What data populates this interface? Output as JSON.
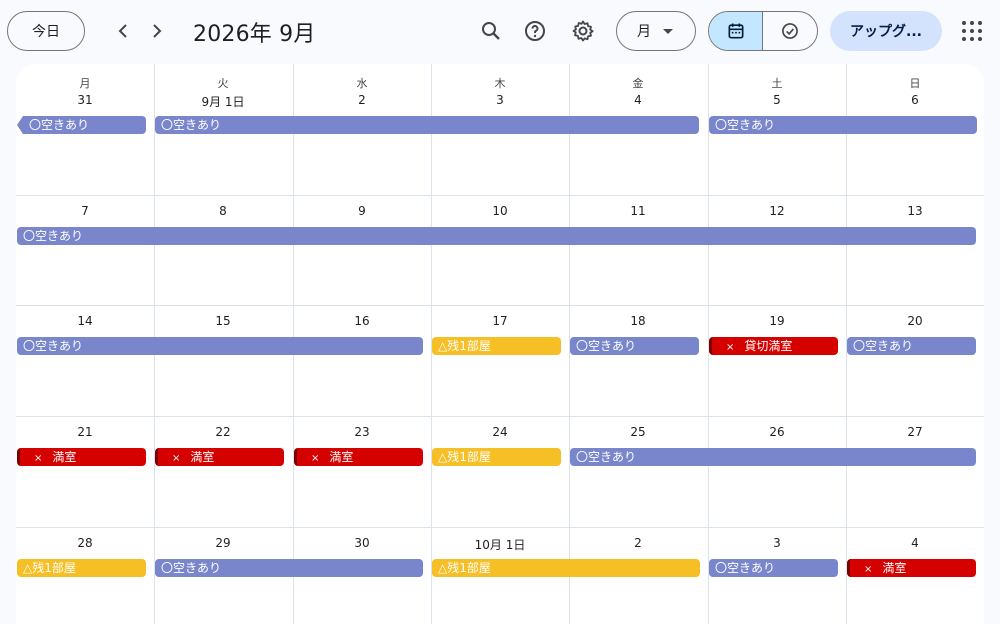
{
  "header": {
    "today_label": "今日",
    "title": "2026年 9月",
    "view_label": "月",
    "upgrade_label": "アップグ..."
  },
  "icons": {
    "prev": "chevron-left-icon",
    "next": "chevron-right-icon",
    "search": "search-icon",
    "help": "help-icon",
    "settings": "gear-icon",
    "calendar_view": "calendar-icon",
    "tasks_view": "task-check-icon",
    "apps": "apps-grid-icon"
  },
  "colors": {
    "available": "#7986cb",
    "few_left": "#f6bf26",
    "full": "#d50000",
    "active_segment": "#c2e7ff"
  },
  "weekdays": [
    "月",
    "火",
    "水",
    "木",
    "金",
    "土",
    "日"
  ],
  "weeks": [
    {
      "days": [
        "31",
        "9月 1日",
        "2",
        "3",
        "4",
        "5",
        "6"
      ]
    },
    {
      "days": [
        "7",
        "8",
        "9",
        "10",
        "11",
        "12",
        "13"
      ]
    },
    {
      "days": [
        "14",
        "15",
        "16",
        "17",
        "18",
        "19",
        "20"
      ]
    },
    {
      "days": [
        "21",
        "22",
        "23",
        "24",
        "25",
        "26",
        "27"
      ]
    },
    {
      "days": [
        "28",
        "29",
        "30",
        "10月 1日",
        "2",
        "3",
        "4"
      ]
    }
  ],
  "events": [
    {
      "week": 0,
      "start": 0,
      "span": 1,
      "type": "avail",
      "label": "〇空きあり",
      "cont_left": true
    },
    {
      "week": 0,
      "start": 1,
      "span": 4,
      "type": "avail",
      "label": "〇空きあり"
    },
    {
      "week": 0,
      "start": 5,
      "span": 2,
      "type": "avail",
      "label": "〇空きあり"
    },
    {
      "week": 1,
      "start": 0,
      "span": 7,
      "type": "avail",
      "label": "〇空きあり"
    },
    {
      "week": 2,
      "start": 0,
      "span": 3,
      "type": "avail",
      "label": "〇空きあり"
    },
    {
      "week": 2,
      "start": 3,
      "span": 1,
      "type": "few",
      "label": "△残1部屋"
    },
    {
      "week": 2,
      "start": 4,
      "span": 1,
      "type": "avail",
      "label": "〇空きあり"
    },
    {
      "week": 2,
      "start": 5,
      "span": 1,
      "type": "full",
      "label": "貸切満室"
    },
    {
      "week": 2,
      "start": 6,
      "span": 1,
      "type": "avail",
      "label": "〇空きあり"
    },
    {
      "week": 3,
      "start": 0,
      "span": 1,
      "type": "full",
      "label": "満室"
    },
    {
      "week": 3,
      "start": 1,
      "span": 1,
      "type": "full",
      "label": "満室"
    },
    {
      "week": 3,
      "start": 2,
      "span": 1,
      "type": "full",
      "label": "満室"
    },
    {
      "week": 3,
      "start": 3,
      "span": 1,
      "type": "few",
      "label": "△残1部屋"
    },
    {
      "week": 3,
      "start": 4,
      "span": 3,
      "type": "avail",
      "label": "〇空きあり"
    },
    {
      "week": 4,
      "start": 0,
      "span": 1,
      "type": "few",
      "label": "△残1部屋"
    },
    {
      "week": 4,
      "start": 1,
      "span": 2,
      "type": "avail",
      "label": "〇空きあり"
    },
    {
      "week": 4,
      "start": 3,
      "span": 2,
      "type": "few",
      "label": "△残1部屋"
    },
    {
      "week": 4,
      "start": 5,
      "span": 1,
      "type": "avail",
      "label": "〇空きあり"
    },
    {
      "week": 4,
      "start": 6,
      "span": 1,
      "type": "full",
      "label": "満室"
    }
  ],
  "full_mark": "×"
}
